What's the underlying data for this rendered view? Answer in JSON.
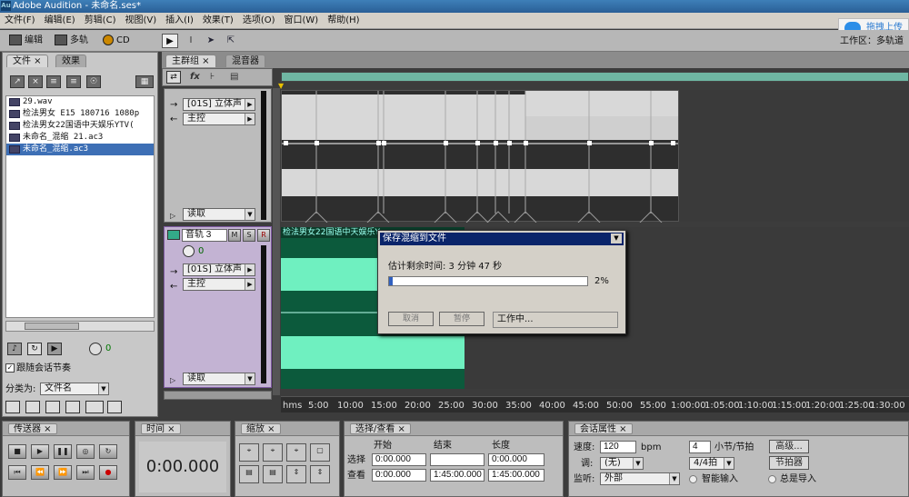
{
  "window": {
    "title": "Adobe Audition - 未命名.ses*",
    "logo": "Au"
  },
  "menu": [
    "文件(F)",
    "编辑(E)",
    "剪辑(C)",
    "视图(V)",
    "插入(I)",
    "效果(T)",
    "选项(O)",
    "窗口(W)",
    "帮助(H)"
  ],
  "upload_button": "拖拽上传",
  "toolbar": {
    "edit": "编辑",
    "multitrack": "多轨",
    "cd": "CD"
  },
  "workspace_label": "工作区：多轨道",
  "left_panel": {
    "tabs": [
      "文件",
      "效果"
    ],
    "files": [
      {
        "name": "29.wav",
        "selected": false
      },
      {
        "name": "检法男女 E15 180716 1080p",
        "selected": false
      },
      {
        "name": "检法男女22国语中天娱乐YTV(",
        "selected": false
      },
      {
        "name": "未命名_混缩 21.ac3",
        "selected": false
      },
      {
        "name": "未命名_混缩.ac3",
        "selected": true
      }
    ],
    "follow_rhythm": "跟随会话节奏",
    "classify_label": "分类为:",
    "classify_value": "文件名",
    "volume_value": "0"
  },
  "main_tabs": [
    "主群组",
    "混音器"
  ],
  "track1": {
    "input": "[01S] 立体声",
    "output": "主控",
    "mode": "读取"
  },
  "track2": {
    "name": "音轨 3",
    "m": "M",
    "s": "S",
    "r": "R",
    "pan": "0",
    "input": "[01S] 立体声",
    "output": "主控",
    "mode": "读取",
    "clip_label": "检法男女22国语中天娱乐Y"
  },
  "ruler_labels": [
    "hms",
    "5:00",
    "10:00",
    "15:00",
    "20:00",
    "25:00",
    "30:00",
    "35:00",
    "40:00",
    "45:00",
    "50:00",
    "55:00",
    "1:00:00",
    "1:05:00",
    "1:10:00",
    "1:15:00",
    "1:20:00",
    "1:25:00",
    "1:30:00"
  ],
  "dialog": {
    "title": "保存混缩到文件",
    "remaining": "估计剩余时间: 3 分钟 47 秒",
    "progress": 2,
    "progress_text": "2%",
    "cancel": "取消",
    "pause": "暂停",
    "status": "工作中..."
  },
  "transport": {
    "title": "传送器"
  },
  "time": {
    "title": "时间",
    "value": "0:00.000"
  },
  "zoom": {
    "title": "缩放"
  },
  "selection": {
    "title": "选择/查看",
    "col_start": "开始",
    "col_end": "结束",
    "col_length": "长度",
    "row_select": "选择",
    "row_view": "查看",
    "select_start": "0:00.000",
    "select_end": "",
    "select_length": "0:00.000",
    "view_start": "0:00.000",
    "view_end": "1:45:00.000",
    "view_length": "1:45:00.000"
  },
  "session": {
    "title": "会话属性",
    "tempo_label": "速度:",
    "tempo_value": "120",
    "tempo_unit": "bpm",
    "beats_value": "4",
    "beats_label": "小节/节拍",
    "advanced": "高级...",
    "key_label": "调:",
    "key_value": "(无)",
    "time_sig": "4/4拍",
    "metronome": "节拍器",
    "monitor_label": "监听:",
    "monitor_value": "外部",
    "smart_input": "智能输入",
    "always_import": "总是导入"
  },
  "colors": {
    "accent": "#0a246a",
    "clip_green": "#6ff0c0",
    "track_selected": "#c3b3d3"
  }
}
